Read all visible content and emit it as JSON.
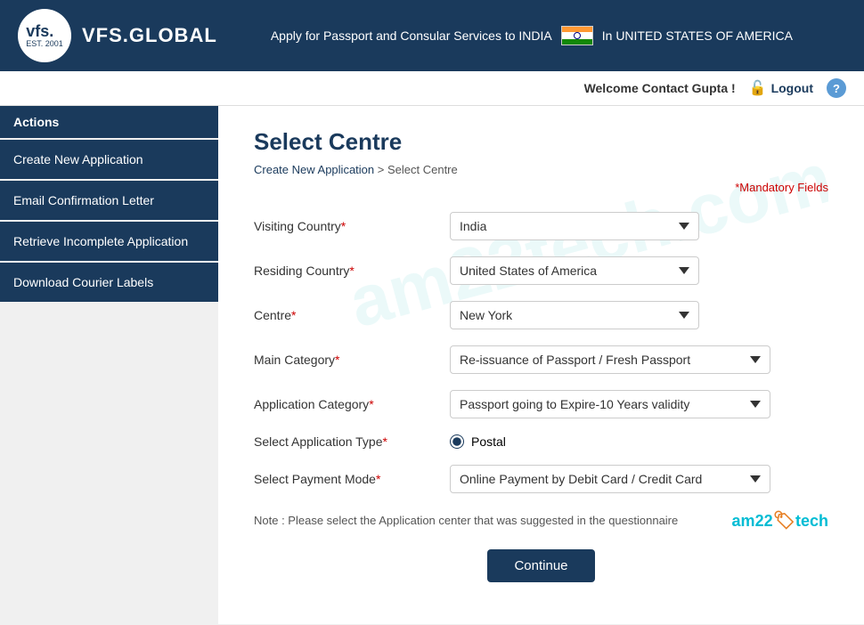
{
  "header": {
    "logo_vfs": "vfs.",
    "logo_est": "EST. 2001",
    "brand_name": "VFS.GLOBAL",
    "tagline": "Apply for Passport and Consular Services to INDIA",
    "country": "In UNITED STATES OF AMERICA"
  },
  "topbar": {
    "welcome": "Welcome Contact Gupta !",
    "logout": "Logout",
    "help": "?"
  },
  "sidebar": {
    "header": "Actions",
    "items": [
      {
        "label": "Create New Application"
      },
      {
        "label": "Email Confirmation Letter"
      },
      {
        "label": "Retrieve Incomplete Application"
      },
      {
        "label": "Download Courier Labels"
      }
    ]
  },
  "page": {
    "title": "Select Centre",
    "breadcrumb_home": "Create New Application",
    "breadcrumb_sep": ">",
    "breadcrumb_current": "Select Centre",
    "mandatory_note": "*Mandatory Fields"
  },
  "form": {
    "visiting_country_label": "Visiting Country",
    "visiting_country_value": "India",
    "residing_country_label": "Residing Country",
    "residing_country_value": "United States of America",
    "centre_label": "Centre",
    "centre_value": "New York",
    "main_category_label": "Main Category",
    "main_category_value": "Re-issuance of Passport / Fresh Passport",
    "app_category_label": "Application Category",
    "app_category_value": "Passport going to Expire-10 Years validity",
    "app_type_label": "Select Application Type",
    "app_type_value": "Postal",
    "payment_mode_label": "Select Payment Mode",
    "payment_mode_value": "Online Payment by Debit Card / Credit Card",
    "note": "Note : Please select the Application center that was suggested in the questionnaire",
    "continue_btn": "Continue"
  },
  "watermark": "am22tech.com",
  "am22": {
    "text1": "am22",
    "icon": "🏷",
    "text2": "tech"
  }
}
